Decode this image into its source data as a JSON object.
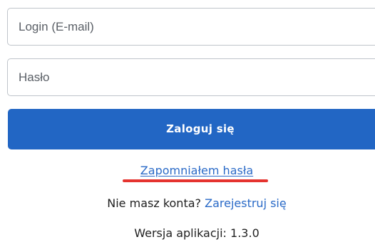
{
  "form": {
    "login_placeholder": "Login (E-mail)",
    "password_placeholder": "Hasło",
    "submit_label": "Zaloguj się"
  },
  "links": {
    "forgot_password": "Zapomniałem hasła",
    "no_account_text": "Nie masz konta?",
    "register": "Zarejestruj się"
  },
  "footer": {
    "version_label": "Wersja aplikacji:",
    "version_number": "1.3.0"
  },
  "colors": {
    "accent": "#2266c4",
    "link": "#2a6ac7",
    "highlight_underline": "#e5332f",
    "input_border": "#bfc4ca"
  }
}
